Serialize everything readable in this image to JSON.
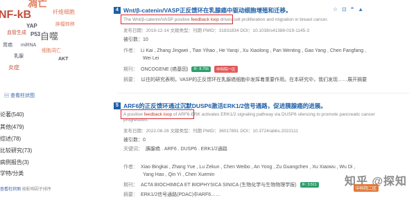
{
  "sidebar": {
    "cloud": [
      "NF-kB",
      "凋亡",
      "纤维细胞",
      "YAP",
      "P53",
      "自噬",
      "肿瘤转移",
      "血管生成",
      "miRNA",
      "乳腺",
      "细胞凋亡",
      "AKT",
      "炎症",
      "胃癌"
    ],
    "view_toggle": "查看柱状图",
    "filters": [
      "论著(540)",
      "其他(479)",
      "综述(78)",
      "比较研究(73)",
      "病例报告(3)",
      "学特/分类"
    ],
    "bottom_view": "查看柱状图",
    "bottom_sort": "按影响因子排序"
  },
  "articles": [
    {
      "number": "4",
      "title": "Wnt/β-catenin/VASP正反馈环在乳腺癌中驱动细胞增殖和迁移。",
      "en_before": "The Wnt/β-catenin/VASP positive ",
      "en_highlight": "feedback loop",
      "en_after": " drives cell proliferation and migration in breast cancer.",
      "meta": "发布日期：2019-12-14  文献类型：刊期  PMID：31831834  DOI：10.1038/s41388-019-1145-3",
      "cited": "被引数：10",
      "authors_label": "作者：",
      "authors": "Li Kai , Zhang Jingwei , Tian Yihao , He Yanqi , Xu Xiaolong , Pan Wenting , Gao Yang , Chen Fangfang ,",
      "authors2": "Wei Lei",
      "journal_label": "期刊：",
      "journal": "ONCOGENE (癌基因)",
      "if_badge": "IF: 8.756",
      "zone_badge": "中科院一区",
      "abstract_label": "摘要：",
      "abstract": "以往的研究表明，VASP的正反馈环在乳腺癌细胞中发挥着重要作用。在本研究中，我们发现……展开摘要"
    },
    {
      "number": "5",
      "title": "ARF6的正反馈环通过沉默DUSP6激活ERK1/2信号通路，促进胰腺癌的进展。",
      "en_before": "A positive ",
      "en_highlight": "feedback loop",
      "en_after": " of ARF6-ERK activates ERK1/2 signaling pathway via DUSP6 silencing to promote pancreatic cancer progression.",
      "meta": "发布日期：2022-08-26  文献类型：刊期  PMID：36017891  DOI：10.3724/abbs.2022111",
      "cited": "被引数：0",
      "keywords_label": "关键词：",
      "keywords": "胰腺癌 . ARF6 . DUSP6 . ERK1/2通路",
      "authors_label": "作者：",
      "authors": "Xiao Bingkai , Zhang Yue , Lu Zekun , Chen Weibo , An Yong , Zu Guangchen , Xu Xiaowu , Wu Di ,",
      "authors2": "Yang Hao , Qin Yi , Chen Xuemin",
      "journal_label": "期刊：",
      "journal": "ACTA BIOCHIMICA ET BIOPHYSICA SINICA (生物化学与生物物理学报)",
      "if_badge": "IF: 3.511",
      "zone_badge": "中科院二区",
      "abstract_label": "摘要：",
      "abstract": "ERK1/2信号通路(PDAC)中ARF6……"
    }
  ],
  "watermark": "知乎 @探知",
  "watermark_badge": "中科院二区",
  "colors": {
    "accent": "#1e5fa8",
    "highlight_box": "#d9232d",
    "if_green": "#2e9e6b",
    "zone_red": "#e05a5a"
  }
}
